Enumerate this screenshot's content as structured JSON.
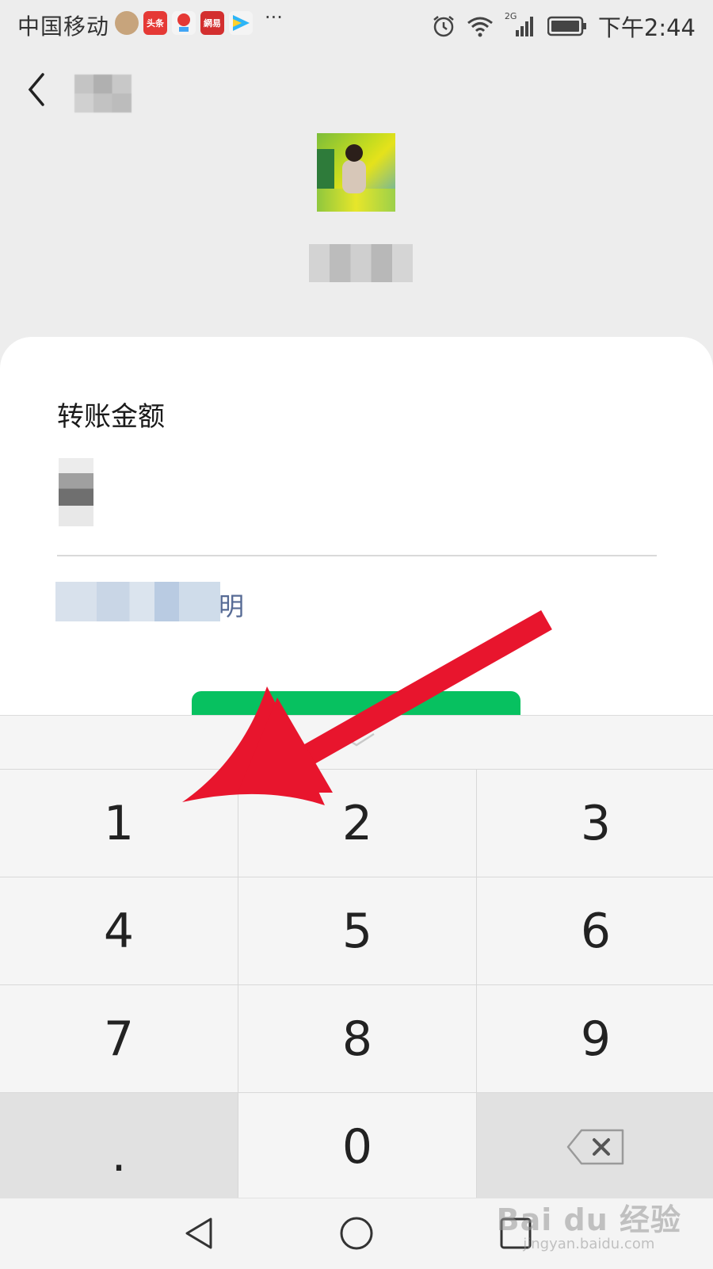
{
  "status_bar": {
    "carrier": "中国移动",
    "time": "下午2:44",
    "network": "2G",
    "notification_icons": [
      {
        "icon": "album-app-icon",
        "label": "",
        "color": "#c7a47c"
      },
      {
        "icon": "toutiao-app-icon",
        "label": "头条",
        "color": "#e53935"
      },
      {
        "icon": "map-app-icon",
        "label": "",
        "color": "#f0f0f0"
      },
      {
        "icon": "netease-news-app-icon",
        "label": "網易",
        "color": "#d32f2f"
      },
      {
        "icon": "video-app-icon",
        "label": "",
        "color": "#f0f0f0"
      }
    ],
    "more": "···"
  },
  "transfer": {
    "amount_label": "转账金额",
    "note_link_tail": "明"
  },
  "keypad": {
    "keys": [
      "1",
      "2",
      "3",
      "4",
      "5",
      "6",
      "7",
      "8",
      "9",
      ".",
      "0"
    ]
  },
  "watermark": {
    "main": "Bai du 经验",
    "sub": "jingyan.baidu.com"
  },
  "colors": {
    "accent_green": "#07c160",
    "link_blue": "#576b95",
    "annotation_red": "#e8152d"
  }
}
